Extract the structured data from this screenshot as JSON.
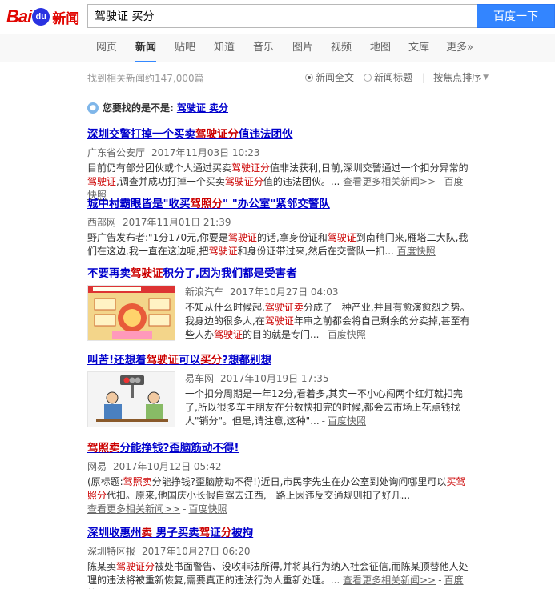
{
  "logo": {
    "bai": "Bai",
    "du": "du",
    "news": "新闻"
  },
  "search": {
    "query": "驾驶证 买分",
    "button": "百度一下"
  },
  "tabs": [
    "网页",
    "新闻",
    "贴吧",
    "知道",
    "音乐",
    "图片",
    "视频",
    "地图",
    "文库",
    "更多»"
  ],
  "info": {
    "count_text": "找到相关新闻约147,000篇"
  },
  "sort": {
    "opt1": "新闻全文",
    "opt2": "新闻标题",
    "focus": "按焦点排序"
  },
  "suggestion": {
    "prompt": "您要找的是不是:",
    "link": "驾驶证 卖分"
  },
  "results": [
    {
      "title_a": "深圳交警打掉一个买卖",
      "title_b": "驾驶证分",
      "title_c": "值违法团伙",
      "source": "广东省公安厅",
      "time": "2017年11月03日 10:23",
      "abs_a": "目前仍有部分团伙或个人通过买卖",
      "abs_b": "驾驶证分",
      "abs_c": "值非法获利,日前,深圳交警通过一个扣分异常的",
      "abs_d": "驾驶证",
      "abs_e": ",调查并成功打掉一个买卖",
      "abs_f": "驾驶证分",
      "abs_g": "值的违法团伙。...",
      "more": "查看更多相关新闻>>",
      "snap": "百度快照"
    },
    {
      "title_a": "城中村霸眼皆是\"收买",
      "title_b": "驾照分",
      "title_c": "\" \"办公室\"紧邻交警队",
      "source": "西部网",
      "time": "2017年11月01日 21:39",
      "abs_a": "野广告发布者:\"1分170元,你要是",
      "abs_b": "驾驶证",
      "abs_c": "的话,拿身份证和",
      "abs_d": "驾驶证",
      "abs_e": "到南稍门来,雁塔二大队,我们在这边,我一直在这边呢,把",
      "abs_f": "驾驶证",
      "abs_g": "和身份证带过来,然后在交警队一扣...",
      "snap": "百度快照"
    },
    {
      "title_a": "不要再卖",
      "title_b": "驾驶证",
      "title_c": "积分了,因为我们都是受害者",
      "source": "新浪汽车",
      "time": "2017年10月27日 04:03",
      "abs_a": "不知从什么时候起,",
      "abs_b": "驾驶证卖",
      "abs_c": "分成了一种产业,并且有愈演愈烈之势。我身边的很多人,在",
      "abs_d": "驾驶证",
      "abs_e": "年审之前都会将自己剩余的分卖掉,甚至有些人办",
      "abs_f": "驾驶证",
      "abs_g": "的目的就是专门...",
      "snap": "百度快照"
    },
    {
      "title_a": "叫苦!还想着",
      "title_b": "驾驶证",
      "title_c": "可以",
      "title_d": "买分",
      "title_e": "?想都别想",
      "source": "易车网",
      "time": "2017年10月19日 17:35",
      "abs_a": "一个扣分周期是一年12分,看着多,其实一不小心闯两个红灯就扣完了,所以很多车主朋友在分数快扣完的时候,都会去市场上花点钱找人\"销分\"。但是,请注意,这种\"...",
      "snap": "百度快照"
    },
    {
      "title_a": "驾照卖",
      "title_b": "分能挣钱?歪脑筋动不得!",
      "source": "网易",
      "time": "2017年10月12日 05:42",
      "abs_a": "(原标题:",
      "abs_b": "驾照卖",
      "abs_c": "分能挣钱?歪脑筋动不得!)近日,市民李先生在办公室到处询问哪里可以",
      "abs_d": "买驾照分",
      "abs_e": "代扣。原来,他国庆小长假自驾去江西,一路上因违反交通规则扣了好几...",
      "more": "查看更多相关新闻>>",
      "snap": "百度快照"
    },
    {
      "title_a": "深圳收惠州",
      "title_b": "卖",
      "title_c": " 男子买卖",
      "title_d": "驾",
      "title_e": "证",
      "title_f": "分",
      "title_g": "被拘",
      "source": "深圳特区报",
      "time": "2017年10月27日 06:20",
      "abs_a": "陈某卖",
      "abs_b": "驾驶证分",
      "abs_c": "被处书面警告、没收非法所得,并将其行为纳入社会征信,而陈某顶替他人处理的违法将被重新恢复,需要真正的违法行为人重新处理。...",
      "more": "查看更多相关新闻>>",
      "snap": "百度快照"
    }
  ]
}
